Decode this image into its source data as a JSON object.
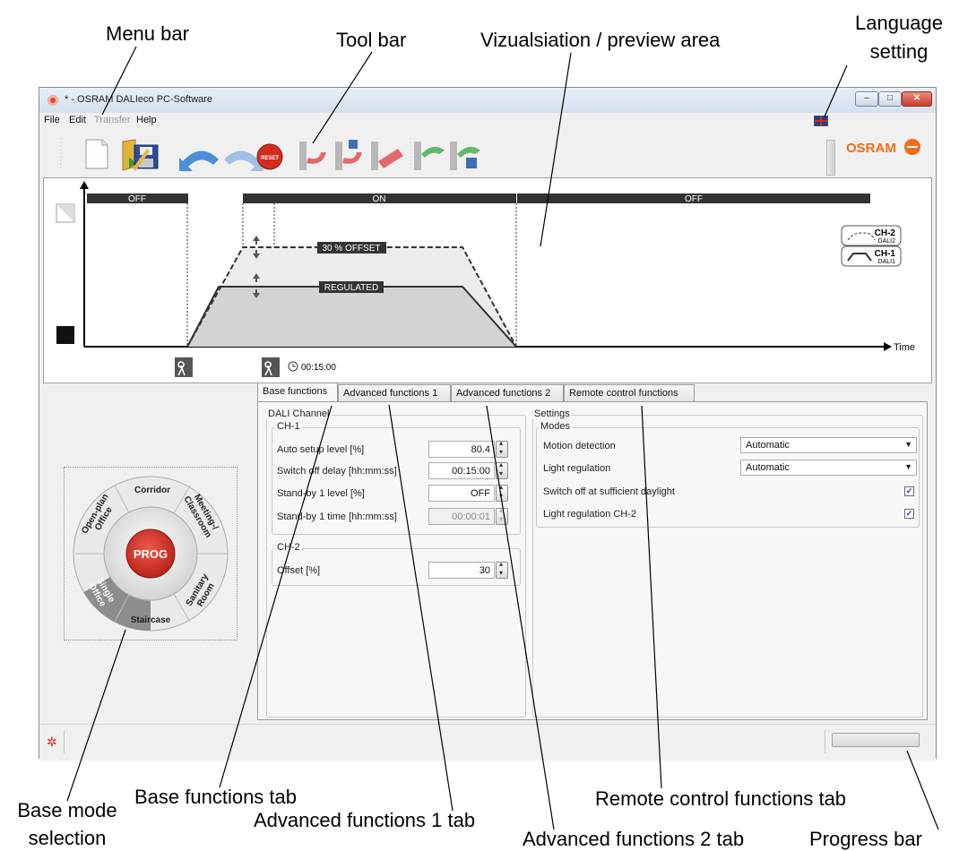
{
  "annotations": {
    "menu_bar": "Menu bar",
    "tool_bar": "Tool bar",
    "viz_area": "Vizualsiation / preview area",
    "language_setting_line1": "Language",
    "language_setting_line2": "setting",
    "base_mode_line1": "Base mode",
    "base_mode_line2": "selection",
    "base_functions_tab": "Base functions tab",
    "advanced_1_tab": "Advanced functions 1 tab",
    "advanced_2_tab": "Advanced functions 2 tab",
    "remote_control_tab": "Remote control functions tab",
    "progress_bar": "Progress bar"
  },
  "window": {
    "title": "* - OSRAM DALIeco PC-Software",
    "controls": {
      "minimize": "–",
      "maximize": "□",
      "close": "✕"
    }
  },
  "menu": {
    "items": [
      {
        "label": "File",
        "enabled": true
      },
      {
        "label": "Edit",
        "enabled": true
      },
      {
        "label": "Transfer",
        "enabled": false
      },
      {
        "label": "Help",
        "enabled": true
      }
    ],
    "language_flag": "uk-flag-icon"
  },
  "toolbar": {
    "buttons": [
      {
        "icon": "new-document-icon"
      },
      {
        "icon": "open-icon"
      },
      {
        "icon": "save-icon"
      },
      {
        "icon": "undo-icon"
      },
      {
        "icon": "redo-icon"
      },
      {
        "icon": "reset-icon",
        "label": "RESET"
      },
      {
        "icon": "read-device-icon"
      },
      {
        "icon": "read-locked-icon"
      },
      {
        "icon": "erase-icon"
      },
      {
        "icon": "write-device-icon"
      },
      {
        "icon": "write-locked-icon"
      }
    ],
    "brand": "OSRAM"
  },
  "visualization": {
    "phases": [
      "OFF",
      "ON",
      "OFF"
    ],
    "offset_label": "30 % OFFSET",
    "regulated_label": "REGULATED",
    "time_axis_label": "Time",
    "timer_value": "00:15:00",
    "legend": [
      {
        "name": "CH-2",
        "sub": "DALI2"
      },
      {
        "name": "CH-1",
        "sub": "DALI1"
      }
    ]
  },
  "base_mode": {
    "center_label": "PROG",
    "segments": [
      "Corridor",
      "Meeting-/\nClassroom",
      "Sanitary\nRoom",
      "Staircase",
      "Single\nOffice",
      "Open-plan\nOffice"
    ],
    "selected": "Single\nOffice"
  },
  "tabs": [
    {
      "label": "Base functions",
      "active": true
    },
    {
      "label": "Advanced functions 1",
      "active": false
    },
    {
      "label": "Advanced functions 2",
      "active": false
    },
    {
      "label": "Remote control functions",
      "active": false
    }
  ],
  "dali_channel": {
    "group_label": "DALI Channel",
    "ch1": {
      "label": "CH-1",
      "fields": [
        {
          "label": "Auto setup level [%]",
          "value": "80.4",
          "enabled": true
        },
        {
          "label": "Switch off delay [hh:mm:ss]",
          "value": "00:15:00",
          "enabled": true
        },
        {
          "label": "Stand-by 1 level [%]",
          "value": "OFF",
          "enabled": true
        },
        {
          "label": "Stand-by 1 time [hh:mm:ss]",
          "value": "00:00:01",
          "enabled": false
        }
      ]
    },
    "ch2": {
      "label": "CH-2",
      "fields": [
        {
          "label": "Offset [%]",
          "value": "30",
          "enabled": true
        }
      ]
    }
  },
  "settings": {
    "group_label": "Settings",
    "modes_label": "Modes",
    "selects": [
      {
        "label": "Motion detection",
        "value": "Automatic"
      },
      {
        "label": "Light regulation",
        "value": "Automatic"
      }
    ],
    "checks": [
      {
        "label": "Switch off at sufficient daylight",
        "checked": true
      },
      {
        "label": "Light regulation CH-2",
        "checked": true
      }
    ]
  },
  "status": {
    "progress": 0
  }
}
